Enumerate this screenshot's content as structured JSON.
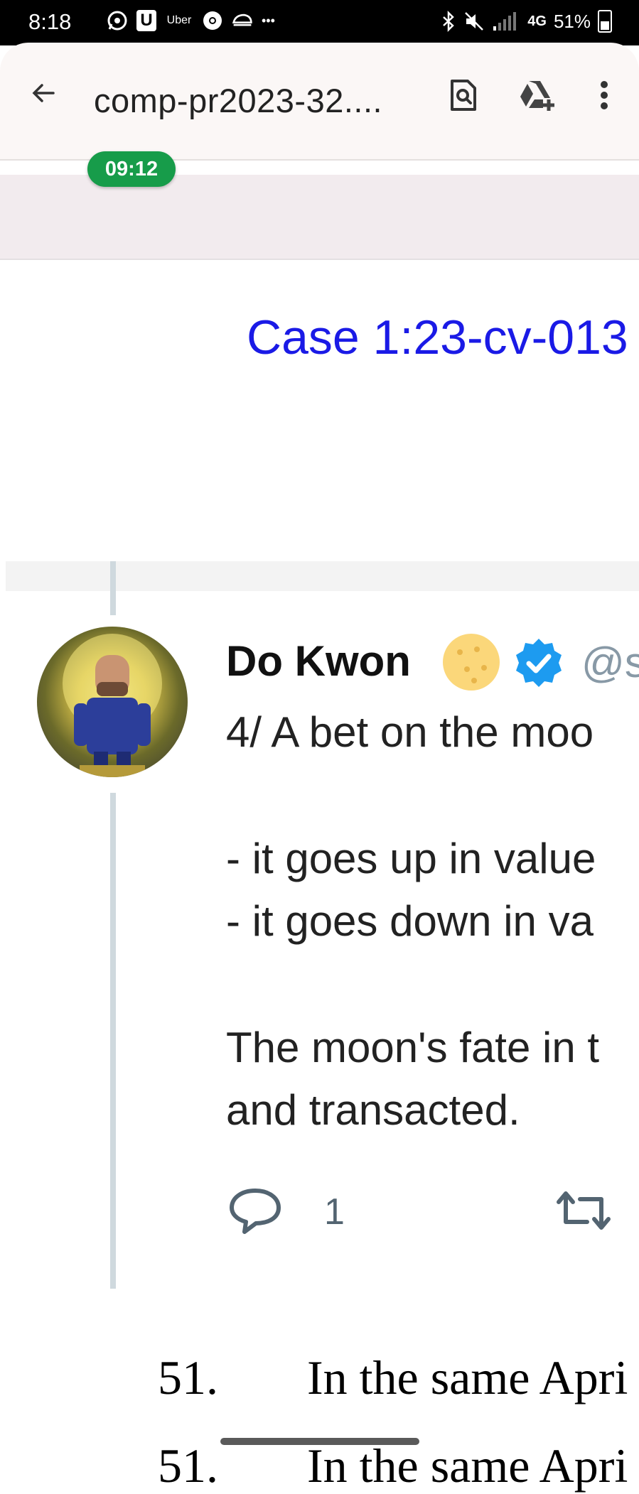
{
  "status_bar": {
    "time": "8:18",
    "app_icons": [
      "whatsapp-icon",
      "u-icon",
      "uber-icon",
      "chrome-icon",
      "helmet-icon"
    ],
    "uber_label": "Uber",
    "u_label": "U",
    "overflow": "•••",
    "battery_percent": "51%",
    "network": "4G"
  },
  "app_bar": {
    "title": "comp-pr2023-32....",
    "actions": [
      "find-in-page-icon",
      "add-to-drive-icon",
      "more-vert-icon"
    ]
  },
  "timer_badge": "09:12",
  "document": {
    "case_header": "Case 1:23-cv-013",
    "tweet": {
      "author": "Do Kwon",
      "handle": "@s",
      "lines": [
        "4/ A bet on the moo",
        "- it goes up in value",
        "- it goes down in va",
        "The moon's fate in t",
        "and transacted."
      ],
      "reply_count": "1"
    },
    "paragraphs": [
      {
        "number": "51.",
        "text": "In the same Apri"
      },
      {
        "number": "51.",
        "text": "In the same Apri"
      }
    ]
  },
  "colors": {
    "status_accent": "#5cb82a",
    "timer_green": "#179c4a",
    "case_blue": "#1a1ae6",
    "verified_blue": "#1d9bf0"
  }
}
